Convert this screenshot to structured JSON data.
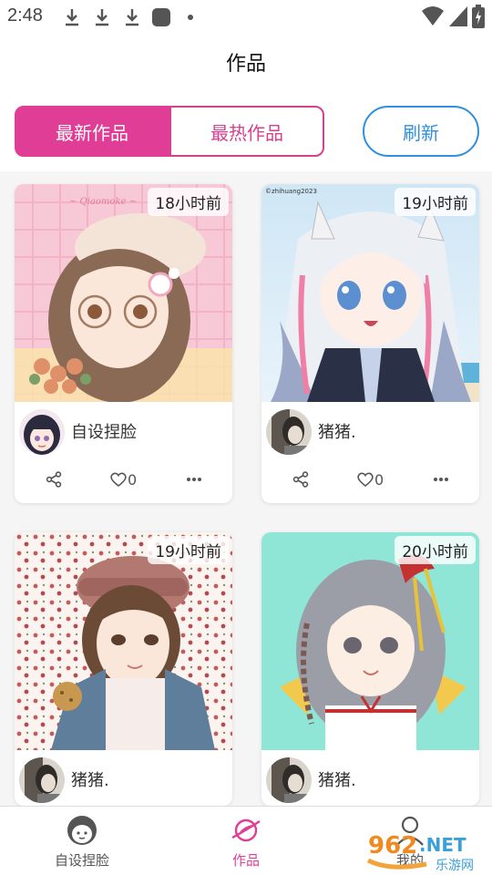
{
  "status_bar": {
    "time": "2:48"
  },
  "header": {
    "title": "作品"
  },
  "tabs": {
    "latest": "最新作品",
    "hottest": "最热作品",
    "refresh": "刷新"
  },
  "works": [
    {
      "time_ago": "18小时前",
      "author": "自设捏脸",
      "likes": "0"
    },
    {
      "time_ago": "19小时前",
      "author": "猪猪.",
      "likes": "0"
    },
    {
      "time_ago": "19小时前",
      "author": "猪猪."
    },
    {
      "time_ago": "20小时前",
      "author": "猪猪."
    }
  ],
  "bottom_nav": [
    {
      "label": "自设捏脸",
      "icon": "face-icon",
      "active": false
    },
    {
      "label": "作品",
      "icon": "planet-icon",
      "active": true
    },
    {
      "label": "我的",
      "icon": "person-icon",
      "active": false
    }
  ],
  "watermark": {
    "brand": "962.NET",
    "sub": "乐游网"
  },
  "colors": {
    "accent_pink": "#e03d97",
    "accent_blue": "#2f8fe0"
  }
}
